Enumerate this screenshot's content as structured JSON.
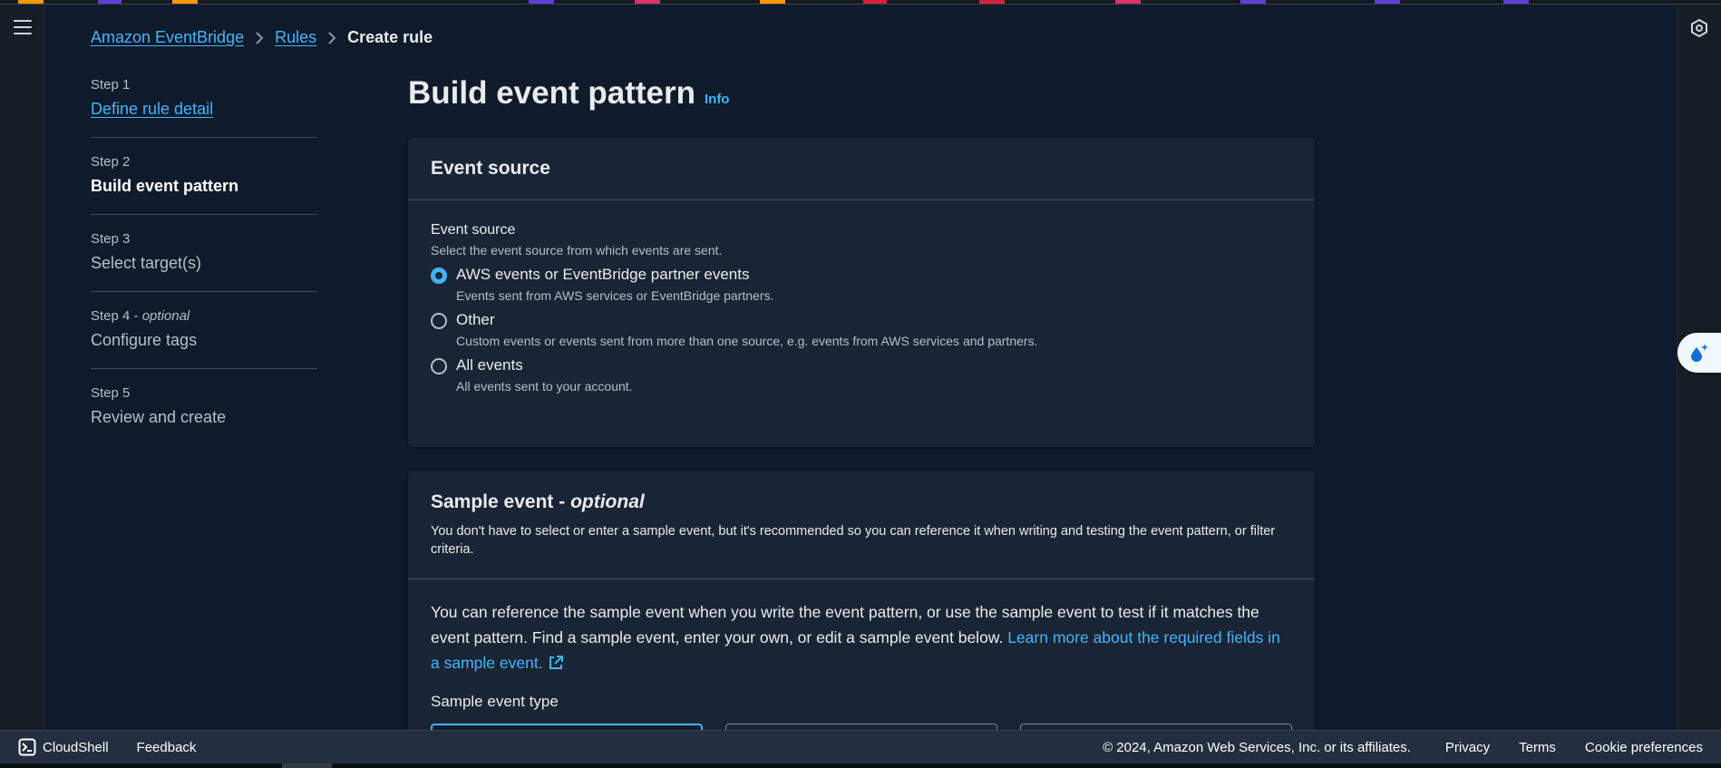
{
  "colors": {
    "accent": "#42b4ff",
    "strip": [
      "#ff9900",
      "#5b3fd6",
      "#ff9900",
      "#5b3fd6",
      "#e0306a",
      "#ff9900",
      "#d6203a",
      "#d6203a",
      "#e0306a",
      "#5b3fd6",
      "#5b3fd6",
      "#5b3fd6"
    ]
  },
  "breadcrumb": {
    "items": [
      "Amazon EventBridge",
      "Rules"
    ],
    "current": "Create rule"
  },
  "steps": [
    {
      "num": "Step 1",
      "label": "Define rule detail"
    },
    {
      "num": "Step 2",
      "label": "Build event pattern"
    },
    {
      "num": "Step 3",
      "label": "Select target(s)"
    },
    {
      "num": "Step 4",
      "num_suffix": "optional",
      "label": "Configure tags"
    },
    {
      "num": "Step 5",
      "label": "Review and create"
    }
  ],
  "page": {
    "title": "Build event pattern",
    "info": "Info"
  },
  "event_source": {
    "header": "Event source",
    "label": "Event source",
    "description": "Select the event source from which events are sent.",
    "options": [
      {
        "title": "AWS events or EventBridge partner events",
        "desc": "Events sent from AWS services or EventBridge partners.",
        "selected": true
      },
      {
        "title": "Other",
        "desc": "Custom events or events sent from more than one source, e.g. events from AWS services and partners.",
        "selected": false
      },
      {
        "title": "All events",
        "desc": "All events sent to your account.",
        "selected": false
      }
    ]
  },
  "sample_event": {
    "header": "Sample event - ",
    "header_italic": "optional",
    "header_desc": "You don't have to select or enter a sample event, but it's recommended so you can reference it when writing and testing the event pattern, or filter criteria.",
    "body_text": "You can reference the sample event when you write the event pattern, or use the sample event to test if it matches the event pattern. Find a sample event, enter your own, or edit a sample event below. ",
    "learn_more": "Learn more about the required fields in a sample event.",
    "type_label": "Sample event type"
  },
  "footer": {
    "cloudshell": "CloudShell",
    "feedback": "Feedback",
    "copyright": "© 2024, Amazon Web Services, Inc. or its affiliates.",
    "links": [
      "Privacy",
      "Terms",
      "Cookie preferences"
    ]
  }
}
